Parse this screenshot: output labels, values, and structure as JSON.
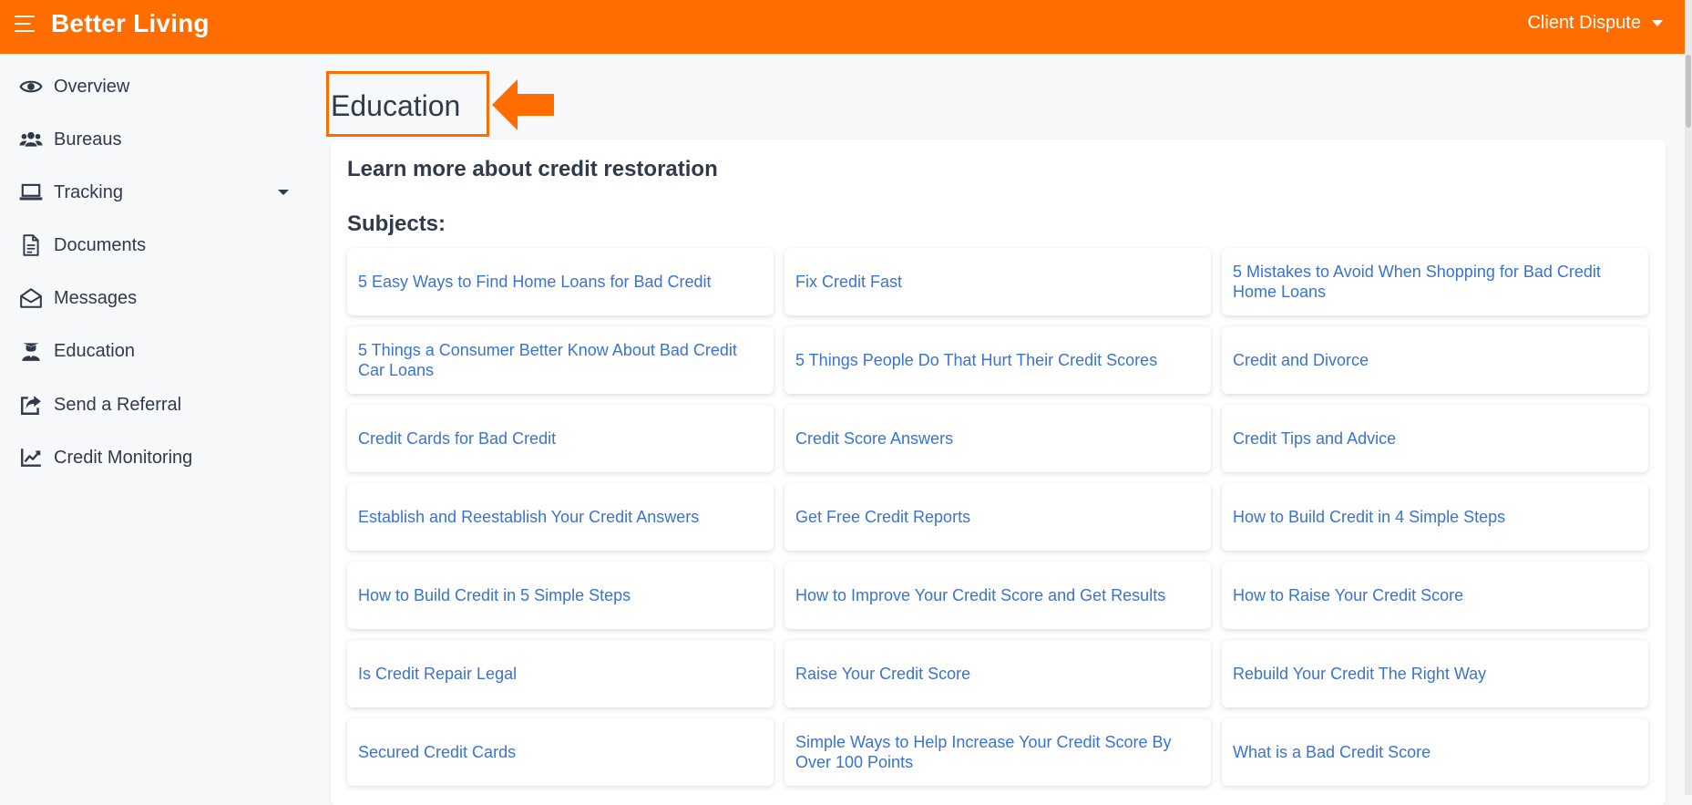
{
  "app": {
    "brand": "Better Living",
    "user_menu_label": "Client Dispute",
    "accent": "#ff6d00",
    "link_color": "#3a73d0"
  },
  "sidebar": {
    "items": [
      {
        "label": "Overview",
        "icon": "eye-icon"
      },
      {
        "label": "Bureaus",
        "icon": "users-icon"
      },
      {
        "label": "Tracking",
        "icon": "laptop-icon",
        "has_dropdown": true
      },
      {
        "label": "Documents",
        "icon": "document-icon"
      },
      {
        "label": "Messages",
        "icon": "envelope-open-icon"
      },
      {
        "label": "Education",
        "icon": "graduate-icon",
        "active": true
      },
      {
        "label": "Send a Referral",
        "icon": "share-icon"
      },
      {
        "label": "Credit Monitoring",
        "icon": "chart-line-icon"
      }
    ]
  },
  "main": {
    "page_title": "Education",
    "card_title": "Learn more about credit restoration",
    "subjects_label": "Subjects:",
    "subjects": [
      "5 Easy Ways to Find Home Loans for Bad Credit",
      "Fix Credit Fast",
      "5 Mistakes to Avoid When Shopping for Bad Credit Home Loans",
      "5 Things a Consumer Better Know About Bad Credit Car Loans",
      "5 Things People Do That Hurt Their Credit Scores",
      "Credit and Divorce",
      "Credit Cards for Bad Credit",
      "Credit Score Answers",
      "Credit Tips and Advice",
      "Establish and Reestablish Your Credit Answers",
      "Get Free Credit Reports",
      "How to Build Credit in 4 Simple Steps",
      "How to Build Credit in 5 Simple Steps",
      "How to Improve Your Credit Score and Get Results",
      "How to Raise Your Credit Score",
      "Is Credit Repair Legal",
      "Raise Your Credit Score",
      "Rebuild Your Credit The Right Way",
      "Secured Credit Cards",
      "Simple Ways to Help Increase Your Credit Score By Over 100 Points",
      "What is a Bad Credit Score"
    ]
  }
}
